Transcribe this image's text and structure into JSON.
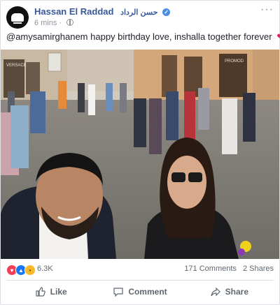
{
  "post": {
    "author_name": "Hassan El Raddad",
    "author_name_arabic": "حسن الرداد",
    "time": "6 mins",
    "text": "@amysamirghanem happy birthday love, inshalla together forever",
    "text_emoji": "❤"
  },
  "photo": {
    "signs": [
      "VERSACE",
      "PROMOD"
    ]
  },
  "reactions": {
    "count": "6.3K",
    "comments": "171 Comments",
    "shares": "2 Shares",
    "icons": [
      "love-icon",
      "like-icon",
      "wow-icon"
    ]
  },
  "actions": {
    "like": "Like",
    "comment": "Comment",
    "share": "Share"
  },
  "colors": {
    "author_link": "#385898",
    "verified": "#4a90e2",
    "love": "#f33e58",
    "like": "#1877f2",
    "wow": "#f7b928"
  }
}
